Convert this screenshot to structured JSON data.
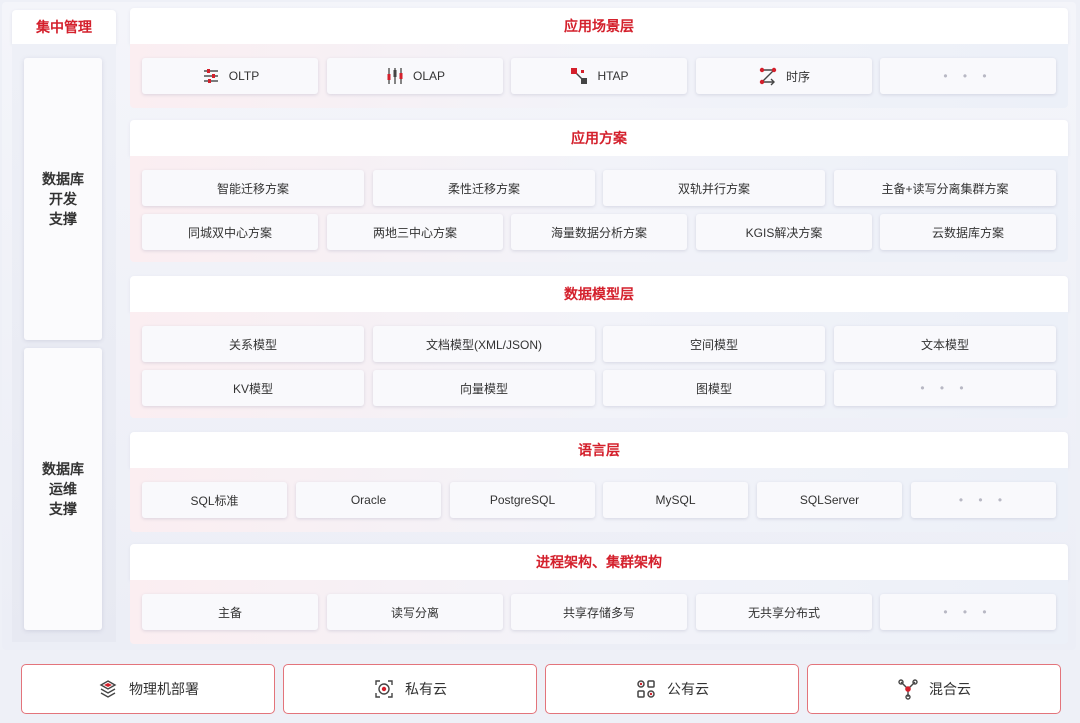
{
  "left": {
    "title": "集中管理",
    "dev_support": "数据库\n开发\n支撑",
    "ops_support": "数据库\n运维\n支撑"
  },
  "app_scenario": {
    "title": "应用场景层",
    "items": [
      {
        "label": "OLTP",
        "icon": "sliders-icon"
      },
      {
        "label": "OLAP",
        "icon": "candlestick-icon"
      },
      {
        "label": "HTAP",
        "icon": "nodes-icon"
      },
      {
        "label": "时序",
        "icon": "time-series-icon"
      },
      {
        "label": "• • •",
        "icon": "more"
      }
    ]
  },
  "app_solution": {
    "title": "应用方案",
    "row1": [
      "智能迁移方案",
      "柔性迁移方案",
      "双轨并行方案",
      "主备+读写分离集群方案"
    ],
    "row2": [
      "同城双中心方案",
      "两地三中心方案",
      "海量数据分析方案",
      "KGIS解决方案",
      "云数据库方案"
    ]
  },
  "data_model": {
    "title": "数据模型层",
    "row1": [
      "关系模型",
      "文档模型(XML/JSON)",
      "空间模型",
      "文本模型"
    ],
    "row2": [
      "KV模型",
      "向量模型",
      "图模型",
      "• • •"
    ]
  },
  "language": {
    "title": "语言层",
    "items": [
      "SQL标准",
      "Oracle",
      "PostgreSQL",
      "MySQL",
      "SQLServer",
      "• • •"
    ]
  },
  "architecture": {
    "title": "进程架构、集群架构",
    "items": [
      "主备",
      "读写分离",
      "共享存储多写",
      "无共享分布式",
      "• • •"
    ]
  },
  "deployment": [
    {
      "label": "物理机部署",
      "icon": "cube-stack-icon"
    },
    {
      "label": "私有云",
      "icon": "target-frame-icon"
    },
    {
      "label": "公有云",
      "icon": "link-nodes-icon"
    },
    {
      "label": "混合云",
      "icon": "hub-icon"
    }
  ],
  "colors": {
    "accent": "#d4202c",
    "border": "#e3747b"
  }
}
